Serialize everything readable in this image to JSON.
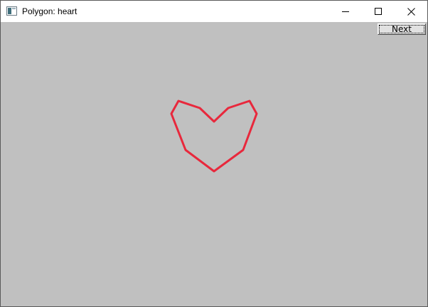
{
  "window": {
    "title": "Polygon: heart",
    "icon": "window-app-icon",
    "controls": [
      "minimize-icon",
      "maximize-icon",
      "close-icon"
    ]
  },
  "toolbar": {
    "next_label": "Next"
  },
  "drawing": {
    "shape": "heart",
    "closed": true,
    "stroke_color": "#e8283c",
    "background_color": "#c0c0c0"
  }
}
